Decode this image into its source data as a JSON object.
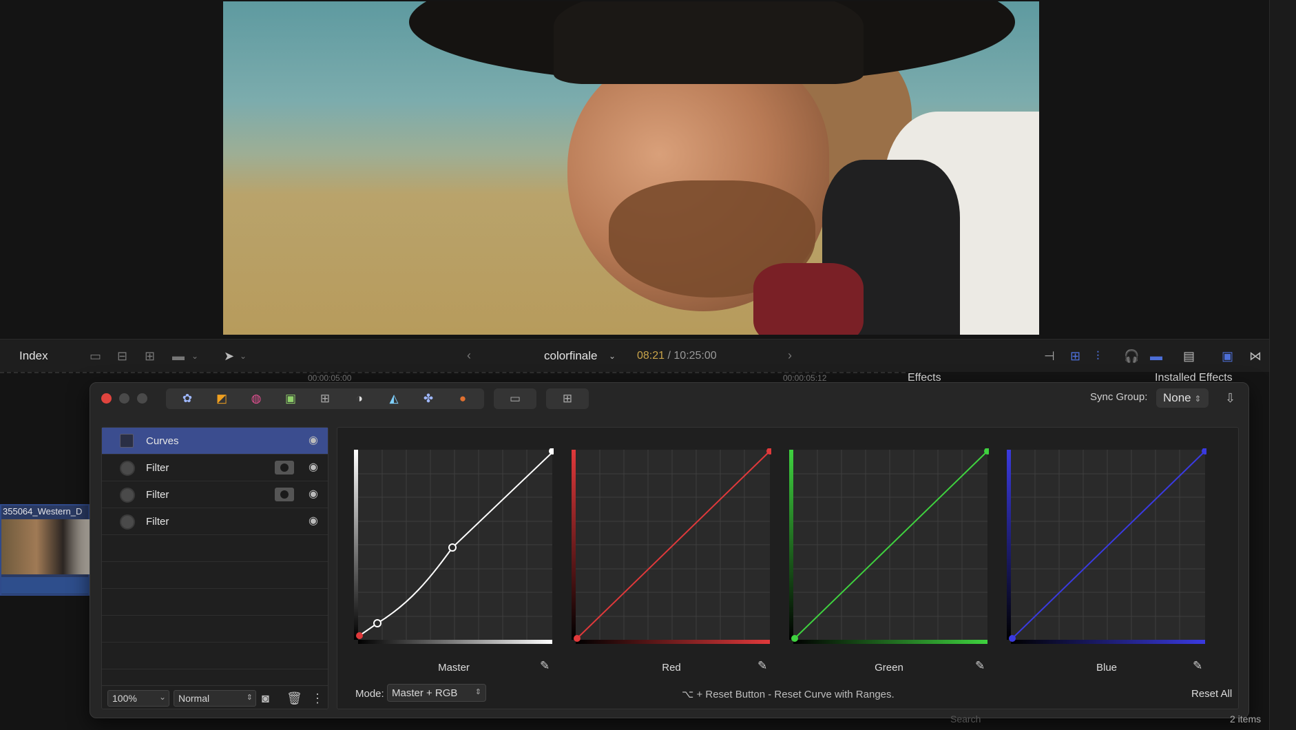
{
  "toolbar": {
    "index_label": "Index",
    "project_name": "colorfinale",
    "timecode_current": "08:21",
    "timecode_separator": " / ",
    "timecode_duration": "10:25:00"
  },
  "ruler": {
    "tick1": "00:00:05:00",
    "tick2": "00:00:05:12",
    "effects_label": "Effects",
    "installed_effects_label": "Installed Effects"
  },
  "clip": {
    "label": "355064_Western_D"
  },
  "panel": {
    "sync_group_label": "Sync Group:",
    "sync_group_value": "None",
    "tools": [
      "color-wheels-icon",
      "curves-icon",
      "hue-icon",
      "lut-icon",
      "grid-icon",
      "exposure-icon",
      "graph-icon",
      "hsl-icon",
      "color-icon"
    ],
    "layers": [
      {
        "name": "Curves",
        "selected": true,
        "mask": false
      },
      {
        "name": "Filter",
        "selected": false,
        "mask": true
      },
      {
        "name": "Filter",
        "selected": false,
        "mask": true
      },
      {
        "name": "Filter",
        "selected": false,
        "mask": false
      }
    ],
    "zoom": "100%",
    "blend_mode": "Normal"
  },
  "curves": {
    "master_label": "Master",
    "red_label": "Red",
    "green_label": "Green",
    "blue_label": "Blue",
    "mode_label": "Mode:",
    "mode_value": "Master + RGB",
    "hint": "⌥ + Reset Button - Reset Curve with Ranges.",
    "reset_all": "Reset All",
    "colors": {
      "master": "#ffffff",
      "red": "#e0393b",
      "green": "#3fd23f",
      "blue": "#3a3ae0"
    }
  },
  "status": {
    "items": "2 items",
    "search": "Search"
  }
}
